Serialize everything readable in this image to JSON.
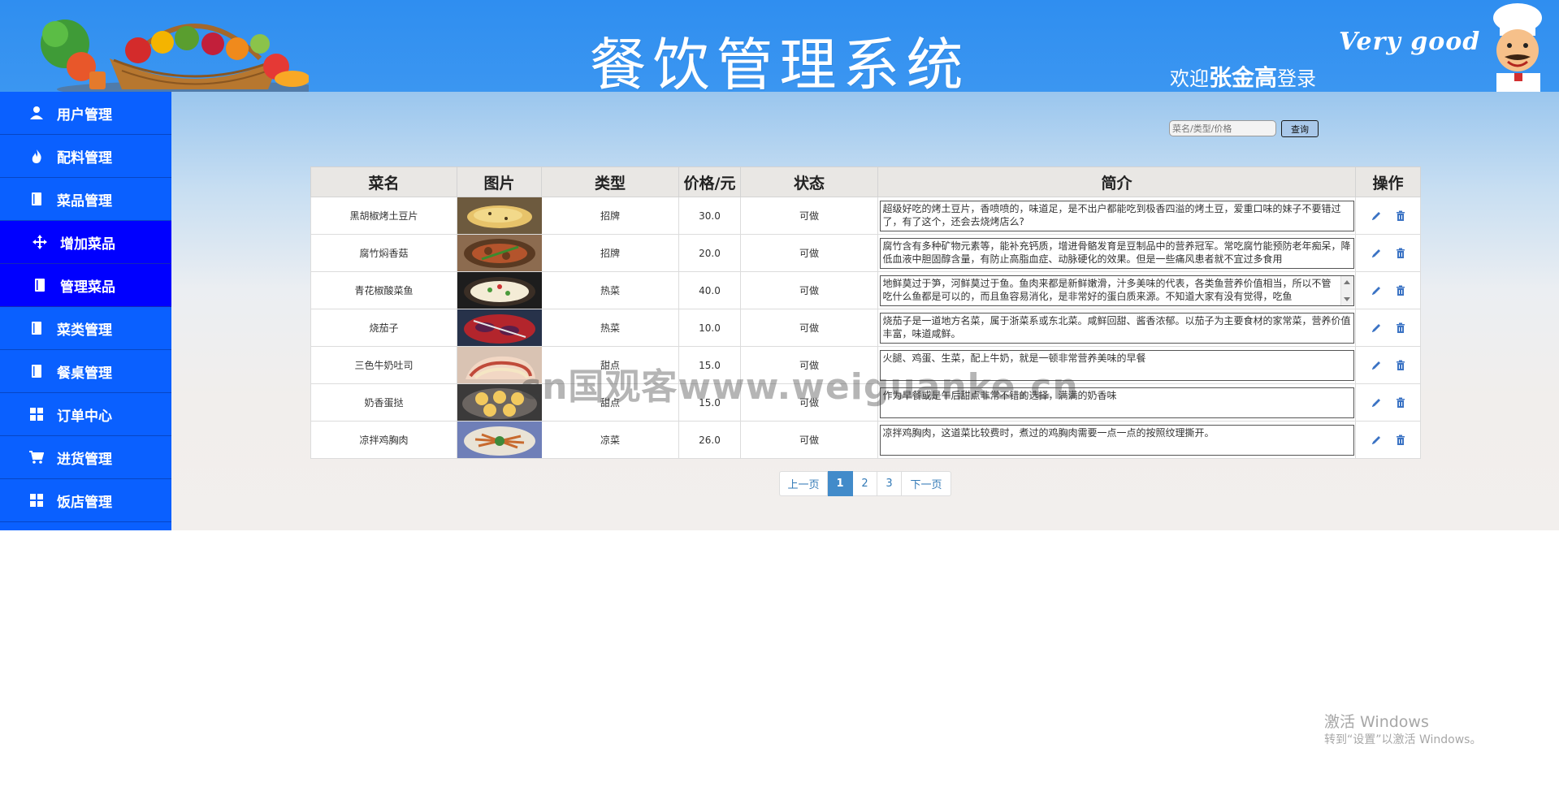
{
  "header": {
    "title": "餐饮管理系统",
    "welcome_prefix": "欢迎",
    "user_name": "张金高",
    "welcome_suffix": "登录",
    "slogan": "Very good"
  },
  "sidebar": {
    "items": [
      {
        "label": "用户管理",
        "icon": "user-icon"
      },
      {
        "label": "配料管理",
        "icon": "fire-icon"
      },
      {
        "label": "菜品管理",
        "icon": "book-icon"
      },
      {
        "label": "增加菜品",
        "icon": "move-icon",
        "sub": true
      },
      {
        "label": "管理菜品",
        "icon": "book-icon",
        "sub": true
      },
      {
        "label": "菜类管理",
        "icon": "book-icon"
      },
      {
        "label": "餐桌管理",
        "icon": "book-icon"
      },
      {
        "label": "订单中心",
        "icon": "grid-icon"
      },
      {
        "label": "进货管理",
        "icon": "cart-icon"
      },
      {
        "label": "饭店管理",
        "icon": "grid-icon"
      }
    ]
  },
  "search": {
    "placeholder": "菜名/类型/价格",
    "button_label": "查询"
  },
  "table": {
    "headers": [
      "菜名",
      "图片",
      "类型",
      "价格/元",
      "状态",
      "简介",
      "操作"
    ],
    "rows": [
      {
        "name": "黑胡椒烤土豆片",
        "type": "招牌",
        "price": "30.0",
        "status": "可做",
        "desc": "超级好吃的烤土豆片，香喷喷的，味道足，是不出户都能吃到极香四溢的烤土豆，爱重口味的妹子不要错过了，有了这个，还会去烧烤店么?"
      },
      {
        "name": "腐竹焖香菇",
        "type": "招牌",
        "price": "20.0",
        "status": "可做",
        "desc": "腐竹含有多种矿物元素等，能补充钙质，增进骨骼发育是豆制品中的营养冠军。常吃腐竹能预防老年痴呆，降低血液中胆固醇含量，有防止高脂血症、动脉硬化的效果。但是一些痛风患者就不宜过多食用"
      },
      {
        "name": "青花椒酸菜鱼",
        "type": "热菜",
        "price": "40.0",
        "status": "可做",
        "desc": "地鲜莫过于笋，河鲜莫过于鱼。鱼肉来都是新鲜嫩滑，汁多美味的代表，各类鱼营养价值相当，所以不管吃什么鱼都是可以的，而且鱼容易消化，是非常好的蛋白质来源。不知道大家有没有觉得，吃鱼"
      },
      {
        "name": "烧茄子",
        "type": "热菜",
        "price": "10.0",
        "status": "可做",
        "desc": "烧茄子是一道地方名菜，属于浙菜系或东北菜。咸鲜回甜、酱香浓郁。以茄子为主要食材的家常菜，营养价值丰富，味道咸鲜。"
      },
      {
        "name": "三色牛奶吐司",
        "type": "甜点",
        "price": "15.0",
        "status": "可做",
        "desc": "火腿、鸡蛋、生菜，配上牛奶，就是一顿非常营养美味的早餐"
      },
      {
        "name": "奶香蛋挞",
        "type": "甜点",
        "price": "15.0",
        "status": "可做",
        "desc": "作为早餐或是午后甜点非常不错的选择，满满的奶香味"
      },
      {
        "name": "凉拌鸡胸肉",
        "type": "凉菜",
        "price": "26.0",
        "status": "可做",
        "desc": "凉拌鸡胸肉，这道菜比较费时，煮过的鸡胸肉需要一点一点的按照纹理撕开。"
      }
    ]
  },
  "pagination": {
    "prev": "上一页",
    "pages": [
      "1",
      "2",
      "3"
    ],
    "next": "下一页",
    "active": "1"
  },
  "watermark": {
    "site": "cn国观客www.weiguanke.cn",
    "win_title": "激活 Windows",
    "win_sub": "转到“设置”以激活 Windows。"
  },
  "colors": {
    "header_bg": "#2f8ef0",
    "sidebar_bg": "#0a60ff",
    "sidebar_sub_bg": "#0000ff",
    "page_active": "#428bca",
    "link": "#337ab7"
  }
}
